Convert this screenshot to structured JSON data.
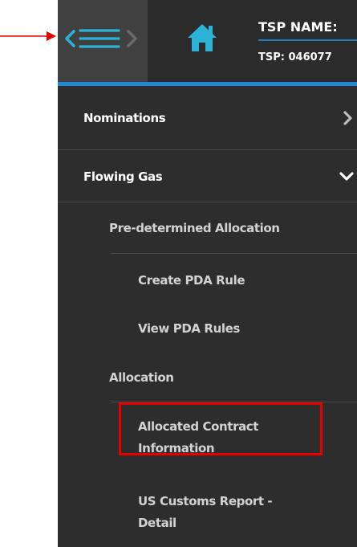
{
  "header": {
    "tsp_name_label": "TSP NAME:",
    "tsp_id_label": "TSP: 046077"
  },
  "icons": {
    "menu_toggle": "hamburger-collapse-icon",
    "home": "home-icon",
    "annotation_arrow": "red-arrow-icon"
  },
  "colors": {
    "panel_bg": "#2d2d2d",
    "toggle_bg": "#404040",
    "accent_blue": "#1e88d2",
    "home_teal": "#2ab3d6",
    "highlight_red": "#e60000"
  },
  "nav": {
    "nominations": "Nominations",
    "flowing_gas": "Flowing Gas",
    "pre_determined_allocation": "Pre-determined Allocation",
    "create_pda_rule": "Create PDA Rule",
    "view_pda_rules": "View PDA Rules",
    "allocation": "Allocation",
    "allocated_contract_line1": "Allocated Contract",
    "allocated_contract_line2": "Information",
    "us_customs_line1": "US Customs Report -",
    "us_customs_line2": "Detail"
  }
}
